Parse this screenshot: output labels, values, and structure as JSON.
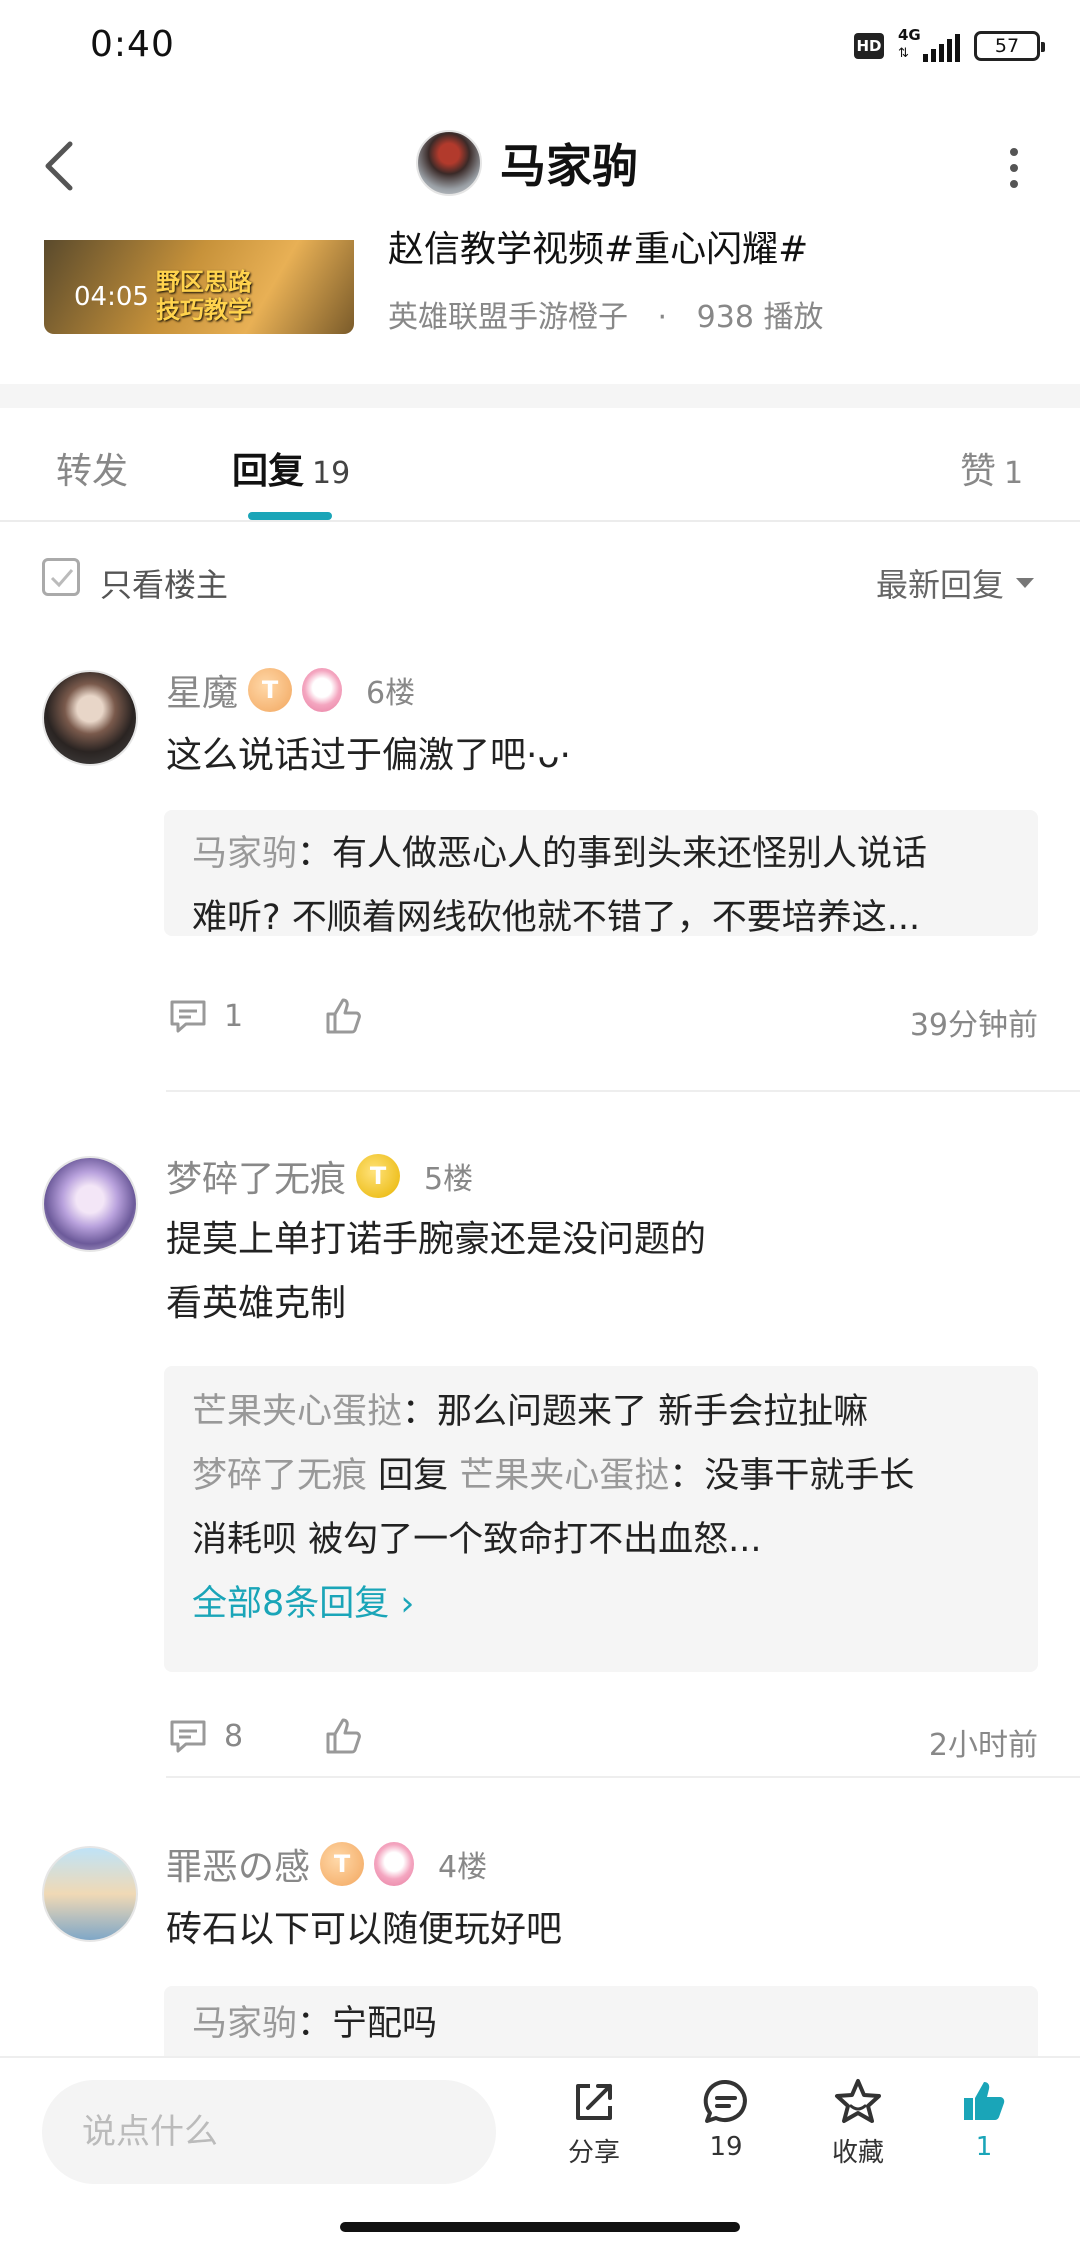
{
  "status_bar": {
    "time": "0:40",
    "hd": "HD",
    "network": "4G",
    "battery": "57"
  },
  "header": {
    "title": "马家驹"
  },
  "video": {
    "duration": "04:05",
    "thumb_caption_line1": "野区思路",
    "thumb_caption_line2": "技巧教学",
    "title": "赵信教学视频#重心闪耀#",
    "author": "英雄联盟手游橙子",
    "sep": "·",
    "plays": "938 播放"
  },
  "tabs": [
    {
      "label": "转发",
      "count": ""
    },
    {
      "label": "回复",
      "count": "19"
    },
    {
      "label": "赞",
      "count": "1"
    }
  ],
  "filter": {
    "only_op_label": "只看楼主",
    "sort_label": "最新回复"
  },
  "comments": [
    {
      "user": "星魔",
      "badge": "T",
      "floor": "6楼",
      "text": "这么说话过于偏激了吧·ᴗ·",
      "quote_user": "马家驹",
      "quote_sep": "：",
      "quote_text_1": "有人做恶心人的事到头来还怪别人说话",
      "quote_text_2": "难听? 不顺着网线砍他就不错了，不要培养这...",
      "reply_count": "1",
      "time": "39分钟前"
    },
    {
      "user": "梦碎了无痕",
      "badge": "T",
      "floor": "5楼",
      "text_1": "提莫上单打诺手腕豪还是没问题的",
      "text_2": "看英雄克制",
      "q1_user": "芒果夹心蛋挞",
      "q1_sep": "：",
      "q1_text": "那么问题来了 新手会拉扯嘛",
      "q2_user": "梦碎了无痕",
      "q2_mid": " 回复 ",
      "q2_target": "芒果夹心蛋挞",
      "q2_sep": "：",
      "q2_text_1": "没事干就手长",
      "q2_text_2": "消耗呗 被勾了一个致命打不出血怒...",
      "all_replies": "全部8条回复 ›",
      "reply_count": "8",
      "time": "2小时前"
    },
    {
      "user": "罪恶の感",
      "badge": "T",
      "floor": "4楼",
      "text": "砖石以下可以随便玩好吧",
      "quote_user": "马家驹",
      "quote_sep": "：",
      "quote_text_1": "宁配吗"
    }
  ],
  "bottom_bar": {
    "placeholder": "说点什么",
    "share_label": "分享",
    "comment_count": "19",
    "collect_label": "收藏",
    "like_count": "1"
  },
  "colors": {
    "accent": "#1aa5b8",
    "muted": "#888888",
    "quote_bg": "#f5f5f5"
  }
}
